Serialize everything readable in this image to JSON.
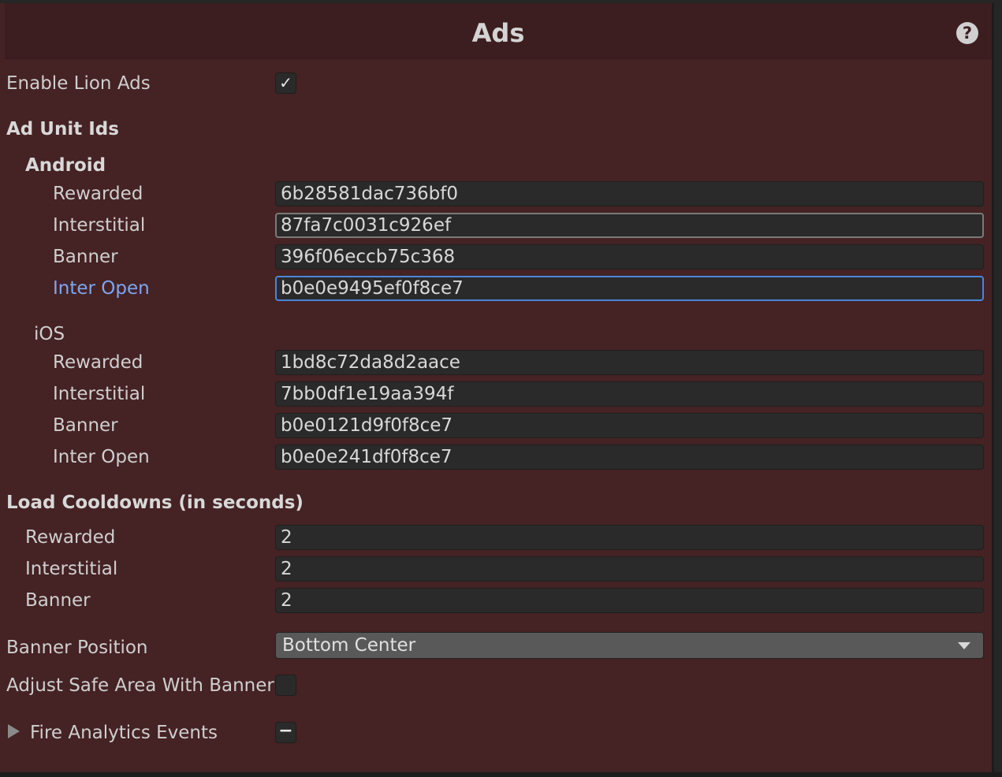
{
  "header": {
    "title": "Ads",
    "help_icon_label": "?"
  },
  "enable_lion_ads": {
    "label": "Enable Lion Ads",
    "checked": true,
    "check_glyph": "✓"
  },
  "ad_unit_ids": {
    "heading": "Ad Unit Ids",
    "android": {
      "heading": "Android",
      "rewarded": {
        "label": "Rewarded",
        "value": "6b28581dac736bf0"
      },
      "interstitial": {
        "label": "Interstitial",
        "value": "87fa7c0031c926ef"
      },
      "banner": {
        "label": "Banner",
        "value": "396f06eccb75c368"
      },
      "inter_open": {
        "label": "Inter Open",
        "value": "b0e0e9495ef0f8ce7"
      }
    },
    "ios": {
      "heading": "iOS",
      "rewarded": {
        "label": "Rewarded",
        "value": "1bd8c72da8d2aace"
      },
      "interstitial": {
        "label": "Interstitial",
        "value": "7bb0df1e19aa394f"
      },
      "banner": {
        "label": "Banner",
        "value": "b0e0121d9f0f8ce7"
      },
      "inter_open": {
        "label": "Inter Open",
        "value": "b0e0e241df0f8ce7"
      }
    }
  },
  "load_cooldowns": {
    "heading": "Load Cooldowns (in seconds)",
    "rewarded": {
      "label": "Rewarded",
      "value": "2"
    },
    "interstitial": {
      "label": "Interstitial",
      "value": "2"
    },
    "banner": {
      "label": "Banner",
      "value": "2"
    }
  },
  "banner_position": {
    "label": "Banner Position",
    "selected": "Bottom Center"
  },
  "adjust_safe_area": {
    "label": "Adjust Safe Area With Banner /",
    "checked": false
  },
  "fire_analytics_events": {
    "label": "Fire Analytics Events",
    "state": "mixed",
    "mixed_glyph": "−"
  },
  "colors": {
    "panel_bg": "#452224",
    "header_bg": "#3d1e20",
    "focus_border": "#4a86d8",
    "active_label": "#7da7f0"
  }
}
